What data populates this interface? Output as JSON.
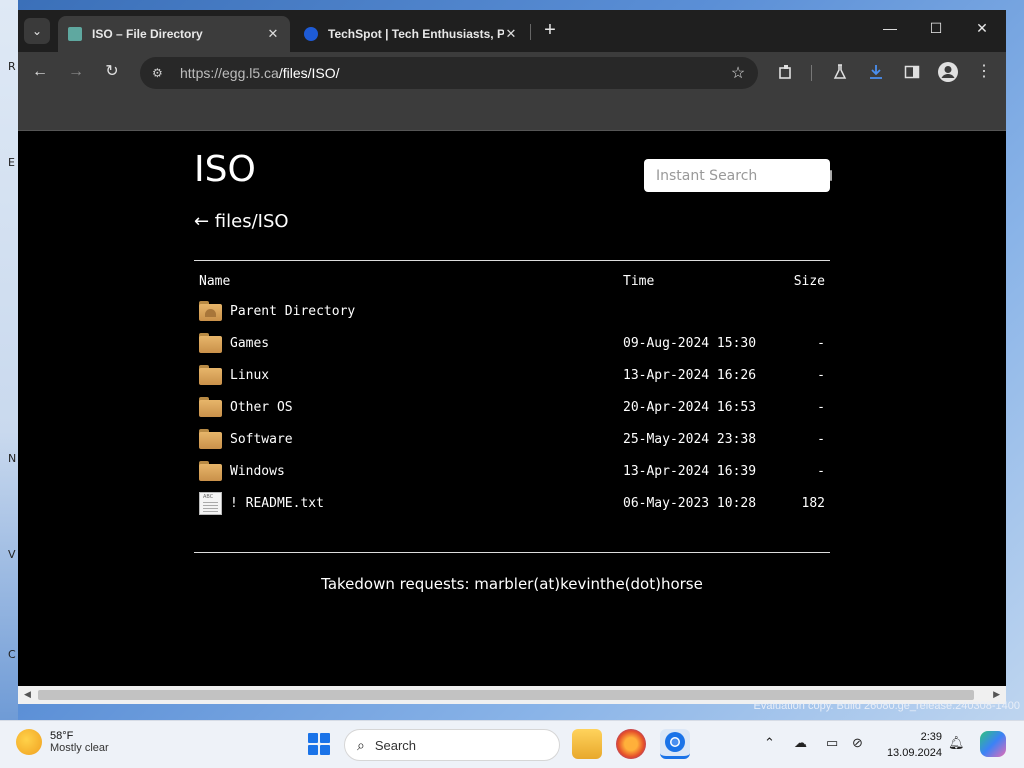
{
  "browser": {
    "tabs": [
      {
        "title": "ISO – File Directory",
        "active": true,
        "close": "✕"
      },
      {
        "title": "TechSpot | Tech Enthusiasts, Po",
        "active": false,
        "close": "✕"
      }
    ],
    "new_tab": "+",
    "window_controls": {
      "minimize": "—",
      "maximize": "☐",
      "close": "✕"
    },
    "url_host": "https://egg.l5.ca",
    "url_path": "/files/ISO/",
    "nav": {
      "back": "←",
      "forward": "→",
      "reload": "↻",
      "star": "☆"
    }
  },
  "page": {
    "title": "ISO",
    "breadcrumb": "← files/ISO",
    "search_placeholder": "Instant Search",
    "columns": {
      "name": "Name",
      "time": "Time",
      "size": "Size"
    },
    "rows": [
      {
        "name": "Parent Directory",
        "time": "",
        "size": "",
        "type": "parent"
      },
      {
        "name": "Games",
        "time": "09-Aug-2024 15:30",
        "size": "-",
        "type": "folder"
      },
      {
        "name": "Linux",
        "time": "13-Apr-2024 16:26",
        "size": "-",
        "type": "folder"
      },
      {
        "name": "Other OS",
        "time": "20-Apr-2024 16:53",
        "size": "-",
        "type": "folder"
      },
      {
        "name": "Software",
        "time": "25-May-2024 23:38",
        "size": "-",
        "type": "folder"
      },
      {
        "name": "Windows",
        "time": "13-Apr-2024 16:39",
        "size": "-",
        "type": "folder"
      },
      {
        "name": "! README.txt",
        "time": "06-May-2023 10:28",
        "size": "182",
        "type": "file"
      }
    ],
    "footer": "Takedown requests: marbler(at)kevinthe(dot)horse"
  },
  "desktop": {
    "watermark": "Evaluation copy. Build 26080.ge_release.240308-1400"
  },
  "taskbar": {
    "weather_temp": "58°F",
    "weather_desc": "Mostly clear",
    "search_label": "Search",
    "time": "2:39",
    "date": "13.09.2024"
  },
  "colors": {
    "page_bg": "#000000",
    "tab_active": "#3c3c3c",
    "tabbar": "#1f1f1f",
    "folder": "#e7b56a"
  }
}
